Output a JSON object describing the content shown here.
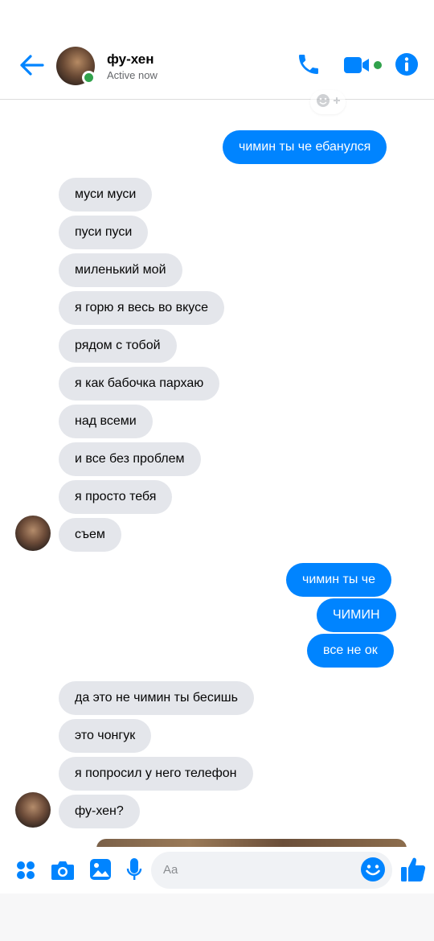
{
  "header": {
    "contact_name": "фу-хен",
    "status": "Active now"
  },
  "messages": [
    {
      "dir": "out",
      "text": "чимин ты че ебанулся"
    },
    {
      "dir": "in",
      "text": "муси муси"
    },
    {
      "dir": "in",
      "text": "пуси пуси"
    },
    {
      "dir": "in",
      "text": "миленький мой"
    },
    {
      "dir": "in",
      "text": "я горю я весь во вкусе"
    },
    {
      "dir": "in",
      "text": "рядом с тобой"
    },
    {
      "dir": "in",
      "text": "я как бабочка пархаю"
    },
    {
      "dir": "in",
      "text": "над всеми"
    },
    {
      "dir": "in",
      "text": "и все без проблем"
    },
    {
      "dir": "in",
      "text": "я просто тебя"
    },
    {
      "dir": "in",
      "text": "съем"
    },
    {
      "dir": "out",
      "text": "чимин ты че"
    },
    {
      "dir": "out",
      "text": "ЧИМИН"
    },
    {
      "dir": "out",
      "text": "все не ок"
    },
    {
      "dir": "in",
      "text": "да это не чимин ты бесишь"
    },
    {
      "dir": "in",
      "text": "это чонгук"
    },
    {
      "dir": "in",
      "text": "я попросил у него телефон"
    },
    {
      "dir": "in",
      "text": "фу-хен?"
    }
  ],
  "composer": {
    "placeholder": "Aa"
  },
  "icons": {
    "back": "arrow-left-icon",
    "call": "phone-icon",
    "video": "video-camera-icon",
    "info": "info-icon",
    "more": "grid-icon",
    "camera": "camera-icon",
    "gallery": "image-icon",
    "voice": "microphone-icon",
    "emoji": "smiley-icon",
    "like": "thumbs-up-icon"
  },
  "colors": {
    "accent": "#0084ff",
    "incoming_bubble": "#e4e6eb",
    "online": "#31a24c"
  }
}
